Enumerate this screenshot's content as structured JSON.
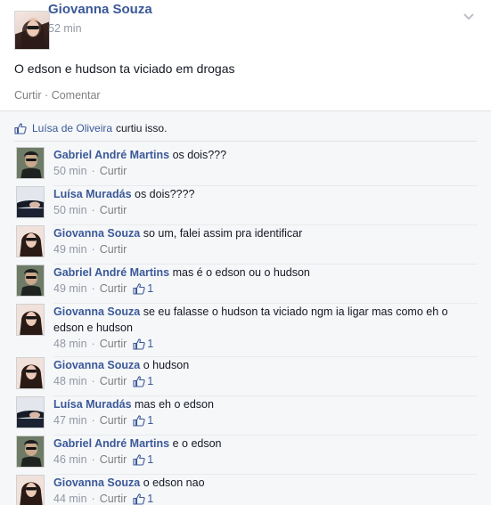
{
  "post": {
    "author": "Giovanna Souza",
    "time": "52 min",
    "text": "O edson e hudson ta viciado em drogas",
    "actions": {
      "like": "Curtir",
      "separator": "·",
      "comment": "Comentar"
    }
  },
  "likes": {
    "name": "Luísa de Oliveira",
    "suffix": "curtiu isso."
  },
  "comments": [
    {
      "author": "Gabriel André Martins",
      "text": "os dois???",
      "time": "50 min",
      "reply": "Curtir",
      "likes": "",
      "avatar": "gabriel"
    },
    {
      "author": "Luísa Muradás",
      "text": "os dois????",
      "time": "50 min",
      "reply": "Curtir",
      "likes": "",
      "avatar": "luisa"
    },
    {
      "author": "Giovanna Souza",
      "text": "so um, falei assim pra identificar",
      "time": "49 min",
      "reply": "Curtir",
      "likes": "",
      "avatar": "giovanna"
    },
    {
      "author": "Gabriel André Martins",
      "text": "mas é o edson ou o hudson",
      "time": "49 min",
      "reply": "Curtir",
      "likes": "1",
      "avatar": "gabriel"
    },
    {
      "author": "Giovanna Souza",
      "text": "se eu falasse o hudson ta viciado ngm ia ligar mas como eh o edson e hudson",
      "time": "48 min",
      "reply": "Curtir",
      "likes": "1",
      "avatar": "giovanna"
    },
    {
      "author": "Giovanna Souza",
      "text": "o hudson",
      "time": "48 min",
      "reply": "Curtir",
      "likes": "1",
      "avatar": "giovanna"
    },
    {
      "author": "Luísa Muradás",
      "text": "mas eh o edson",
      "time": "47 min",
      "reply": "Curtir",
      "likes": "1",
      "avatar": "luisa"
    },
    {
      "author": "Gabriel André Martins",
      "text": "e o edson",
      "time": "46 min",
      "reply": "Curtir",
      "likes": "1",
      "avatar": "gabriel"
    },
    {
      "author": "Giovanna Souza",
      "text": "o edson nao",
      "time": "44 min",
      "reply": "Curtir",
      "likes": "1",
      "avatar": "giovanna"
    }
  ],
  "colors": {
    "link": "#3b5998",
    "meta": "#9197a3",
    "ufi_bg": "#f6f7f9"
  },
  "icons": {
    "like": "thumbs-up-icon",
    "menu": "chevron-down-icon"
  }
}
